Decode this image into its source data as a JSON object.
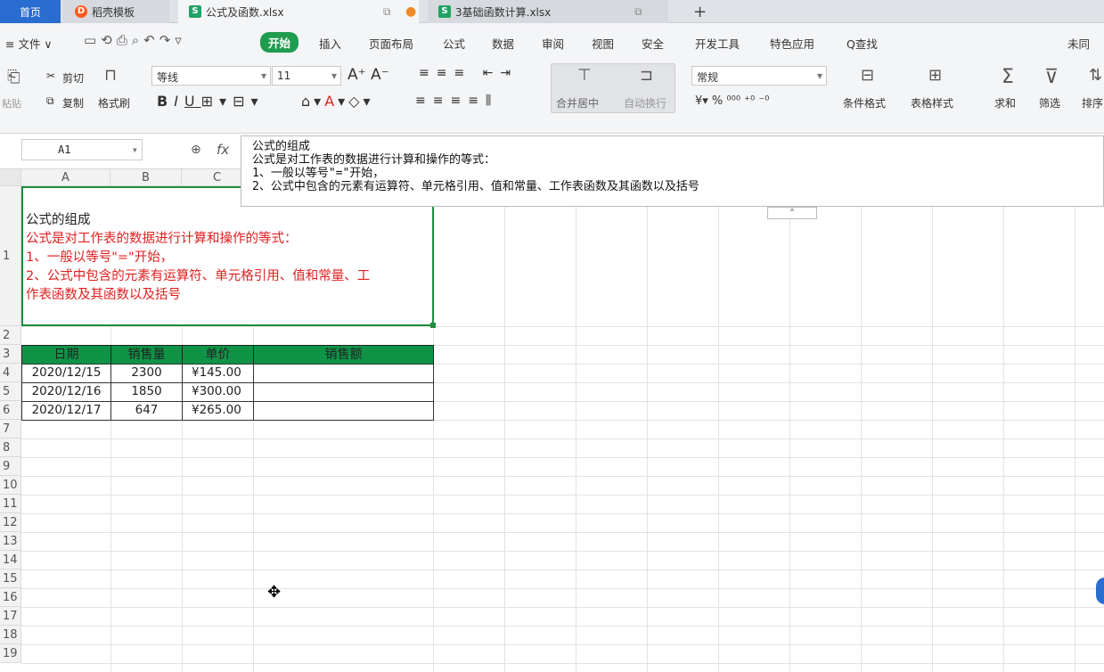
{
  "tabs": {
    "home": "首页",
    "template": "稻壳模板",
    "file1": "公式及函数.xlsx",
    "file2": "3基础函数计算.xlsx",
    "add": "+"
  },
  "menu": {
    "file": "≡ 文件 ∨",
    "start": "开始",
    "items": [
      "插入",
      "页面布局",
      "公式",
      "数据",
      "审阅",
      "视图",
      "安全",
      "开发工具",
      "特色应用"
    ],
    "search": "Q查找",
    "right": "未同"
  },
  "ribbon": {
    "paste": "粘贴",
    "cut": "剪切",
    "copy": "复制",
    "format_painter": "格式刷",
    "font_name": "等线",
    "font_size": "11",
    "merge": "合并居中",
    "wrap": "自动换行",
    "number_format": "常规",
    "cond_format": "条件格式",
    "table_style": "表格样式",
    "sum": "求和",
    "filter": "筛选",
    "sort": "排序"
  },
  "formula_bar": {
    "name_box": "A1",
    "fx": "fx",
    "lines": [
      "公式的组成",
      "公式是对工作表的数据进行计算和操作的等式：",
      "1、一般以等号\"=\"开始，",
      "2、公式中包含的元素有运算符、单元格引用、值和常量、工作表函数及其函数以及括号"
    ]
  },
  "columns": [
    "A",
    "B",
    "C"
  ],
  "rows": [
    "1",
    "2",
    "3",
    "4",
    "5",
    "6",
    "7",
    "8",
    "9",
    "10",
    "11",
    "12",
    "13",
    "14",
    "15",
    "16",
    "17",
    "18",
    "19"
  ],
  "a1": {
    "title": "公式的组成",
    "lines": [
      "公式是对工作表的数据进行计算和操作的等式：",
      "1、一般以等号\"=\"开始，",
      "2、公式中包含的元素有运算符、单元格引用、值和常量、工",
      "作表函数及其函数以及括号"
    ]
  },
  "table": {
    "headers": [
      "日期",
      "销售量",
      "单价",
      "销售额"
    ],
    "rows": [
      [
        "2020/12/15",
        "2300",
        "¥145.00",
        ""
      ],
      [
        "2020/12/16",
        "1850",
        "¥300.00",
        ""
      ],
      [
        "2020/12/17",
        "647",
        "¥265.00",
        ""
      ]
    ]
  },
  "colors": {
    "accent_green": "#0f9447",
    "red_text": "#e02020",
    "tab_blue": "#2a6dd0"
  }
}
